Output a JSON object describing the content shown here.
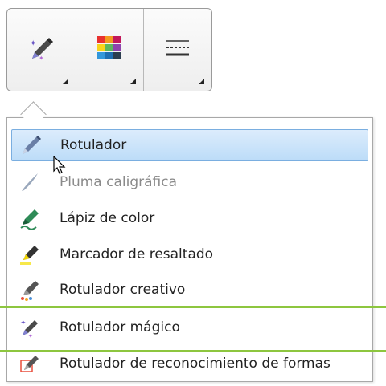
{
  "toolbar": {
    "buttons": [
      {
        "name": "pen-type-button",
        "icon": "magic-pen-icon"
      },
      {
        "name": "color-palette-button",
        "icon": "color-grid-icon"
      },
      {
        "name": "line-style-button",
        "icon": "line-style-icon"
      }
    ]
  },
  "menu": {
    "items": [
      {
        "label": "Rotulador",
        "icon": "marker-icon",
        "state": "hover"
      },
      {
        "label": "Pluma caligráfica",
        "icon": "calligraphy-pen-icon",
        "state": "disabled"
      },
      {
        "label": "Lápiz de color",
        "icon": "crayon-icon",
        "state": "normal"
      },
      {
        "label": "Marcador de resaltado",
        "icon": "highlighter-icon",
        "state": "normal"
      },
      {
        "label": "Rotulador creativo",
        "icon": "creative-pen-icon",
        "state": "normal"
      },
      {
        "label": "Rotulador mágico",
        "icon": "magic-pen-icon",
        "state": "highlighted"
      },
      {
        "label": "Rotulador de reconocimiento de formas",
        "icon": "shape-recognition-pen-icon",
        "state": "normal"
      }
    ]
  },
  "colors": {
    "hover_bg": "#c8e2fa",
    "highlight_outline": "#8dc63f"
  }
}
